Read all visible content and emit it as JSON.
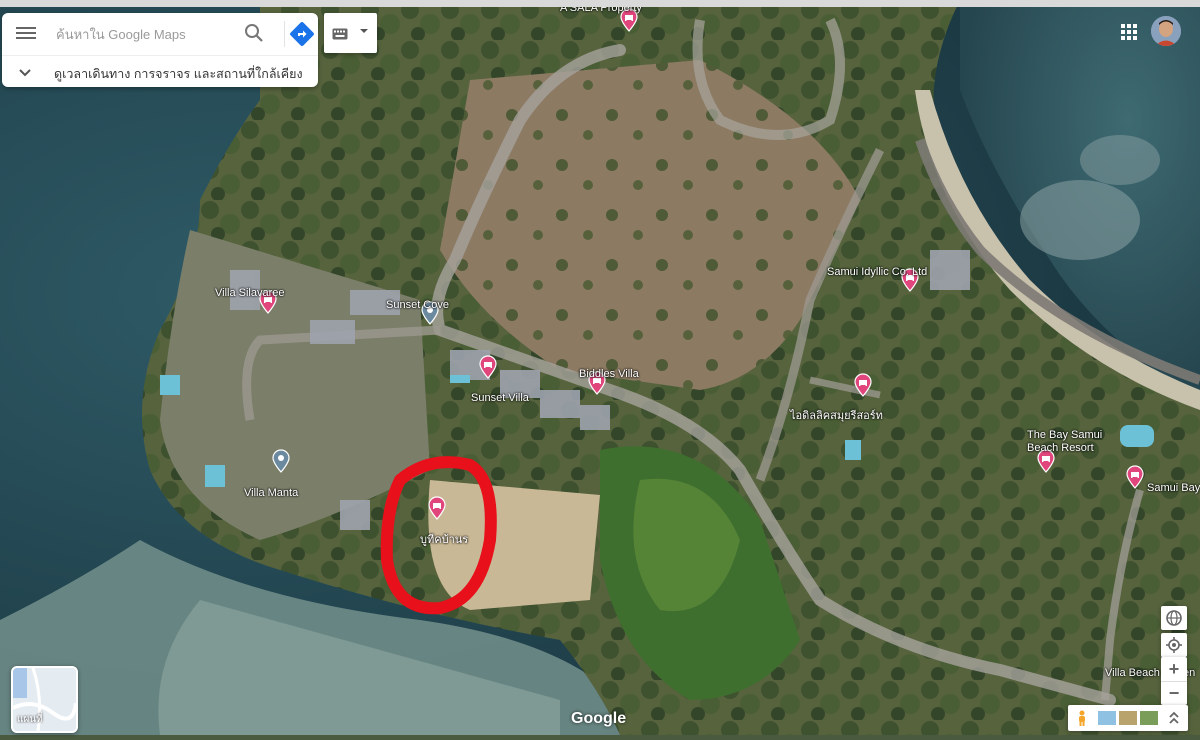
{
  "search": {
    "placeholder": "ค้นหาใน Google Maps",
    "explore_label": "ดูเวลาเดินทาง การจราจร และสถานที่ใกล้เคียง"
  },
  "places": [
    {
      "name": "Villa Silavaree",
      "type": "hotel"
    },
    {
      "name": "Sunset Cove",
      "type": "poi"
    },
    {
      "name": "Sunset Villa",
      "type": "hotel"
    },
    {
      "name": "Biddles Villa",
      "type": "hotel"
    },
    {
      "name": "Villa Manta",
      "type": "poi"
    },
    {
      "name": "บูทีคบ้านร",
      "type": "hotel"
    },
    {
      "name": "Samui Idyllic Co. Ltd",
      "type": "hotel"
    },
    {
      "name": "ไอดิลลิคสมุยรีสอร์ท",
      "type": "hotel"
    },
    {
      "name": "The Bay Samui Beach Resort",
      "type": "hotel"
    },
    {
      "name": "Samui Bay",
      "type": "hotel"
    },
    {
      "name": "Villa Beach",
      "type": "hotel"
    },
    {
      "name": "A SALA Property",
      "type": "hotel"
    }
  ],
  "label_lines": {
    "bay_line1": "The Bay Samui",
    "bay_line2": "Beach Resort",
    "villa_beach": "Villa Beach",
    "villa_beach_tail": "en",
    "asala": "A SALA Property"
  },
  "layer": {
    "label": "แผนที่"
  },
  "attribution": {
    "logo": "Google"
  },
  "colors": {
    "hotel_pin": "#e0457b",
    "poi_pin": "#6b8aa0",
    "highlight": "#e8101a",
    "sea": "#2b4e5a",
    "land": "#6d7451"
  },
  "icons": {
    "menu": "menu-icon",
    "search": "search-icon",
    "directions": "directions-icon",
    "keyboard": "keyboard-icon",
    "apps": "apps-grid-icon",
    "globe": "globe-icon",
    "location": "my-location-icon",
    "pegman": "pegman-icon",
    "expand": "expand-icon"
  }
}
